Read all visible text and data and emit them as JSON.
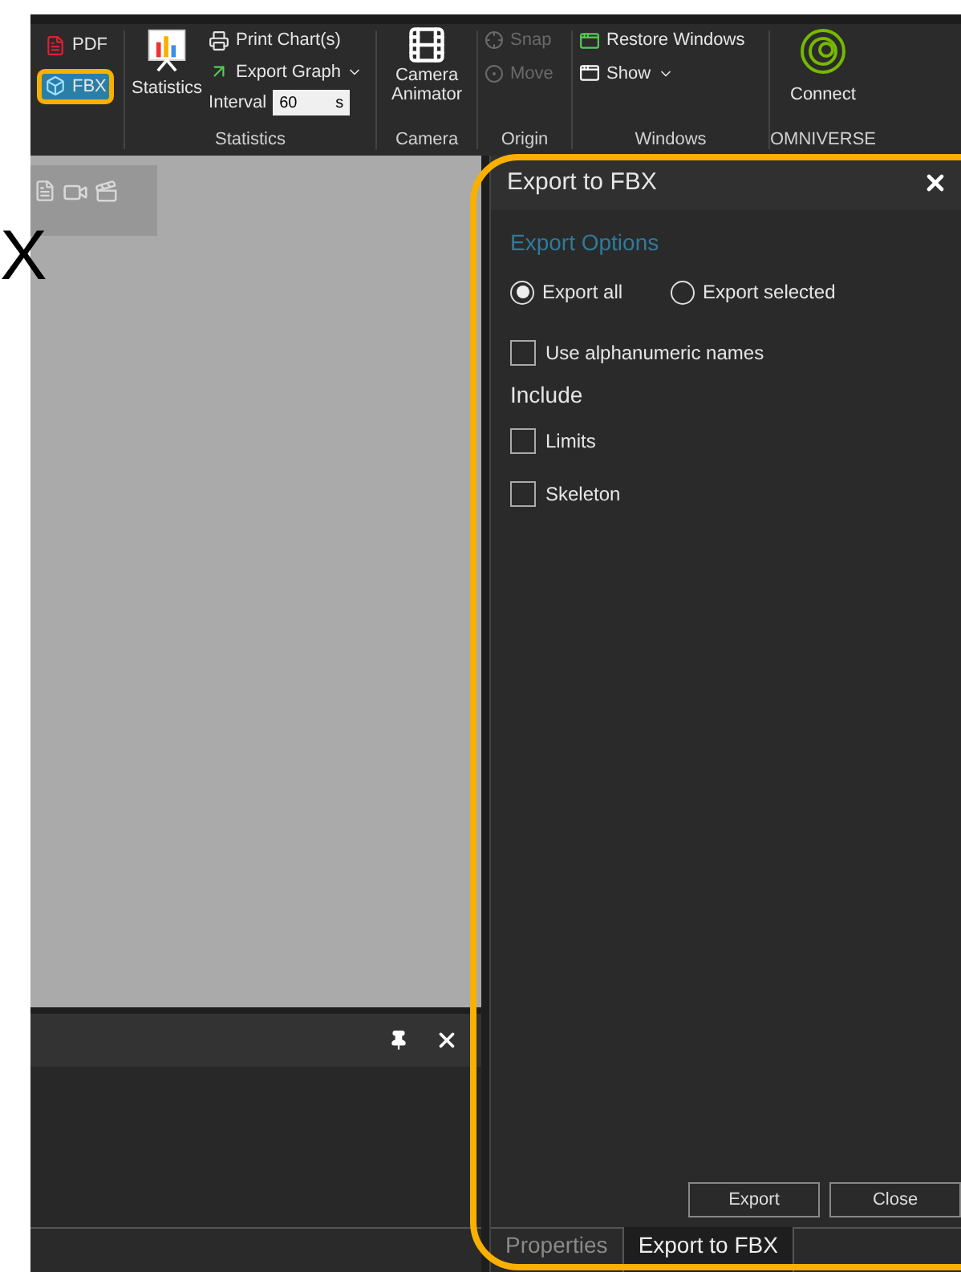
{
  "export_menu": [
    {
      "label": "PDF",
      "kind": "pdf",
      "highlighted": false
    },
    {
      "label": "FBX",
      "kind": "fbx",
      "highlighted": true
    }
  ],
  "statistics": {
    "button": "Statistics",
    "print": "Print Chart(s)",
    "export_graph": "Export Graph",
    "interval_label": "Interval",
    "interval_value": "60",
    "interval_unit": "s",
    "group_label": "Statistics"
  },
  "camera": {
    "button": "Camera Animator",
    "group_label": "Camera"
  },
  "origin": {
    "items": [
      {
        "label": "Snap",
        "kind": "snap",
        "disabled": true
      },
      {
        "label": "Move",
        "kind": "move",
        "disabled": true
      }
    ],
    "group_label": "Origin"
  },
  "windows": {
    "items": [
      {
        "label": "Restore Windows",
        "kind": "restore"
      },
      {
        "label": "Show",
        "kind": "show"
      }
    ],
    "group_label": "Windows"
  },
  "omniverse": {
    "button": "Connect",
    "group_label": "OMNIVERSE"
  },
  "background_text": "X",
  "export_panel": {
    "title": "Export to FBX",
    "highlighted": true,
    "section": "Export Options",
    "scope": [
      {
        "label": "Export all",
        "selected": true
      },
      {
        "label": "Export selected",
        "selected": false
      }
    ],
    "alphanumeric": {
      "label": "Use alphanumeric names",
      "checked": false
    },
    "include_label": "Include",
    "include": [
      {
        "label": "Limits",
        "checked": false
      },
      {
        "label": "Skeleton",
        "checked": false
      }
    ],
    "buttons": [
      "Export",
      "Close"
    ],
    "tabs": [
      {
        "label": "Properties",
        "selected": false
      },
      {
        "label": "Export to FBX",
        "selected": true
      }
    ]
  }
}
